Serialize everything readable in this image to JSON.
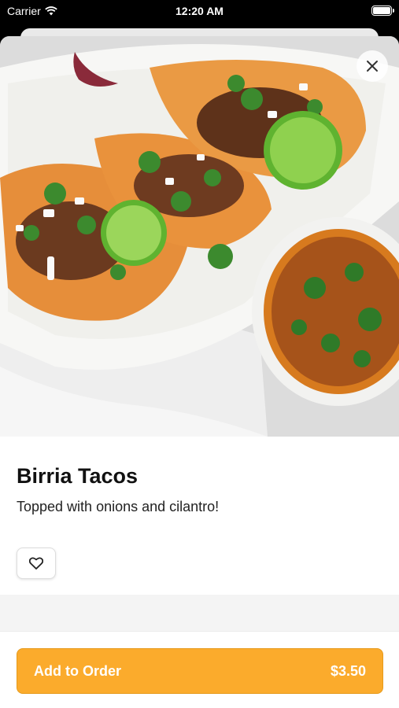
{
  "status_bar": {
    "carrier": "Carrier",
    "time": "12:20 AM"
  },
  "item": {
    "name": "Birria Tacos",
    "description": "Topped with onions and cilantro!",
    "image_icon": "food-photo"
  },
  "actions": {
    "close_icon": "close-icon",
    "favorite_icon": "heart-icon"
  },
  "order": {
    "label": "Add to Order",
    "price": "$3.50"
  },
  "colors": {
    "accent": "#fbab2c",
    "accent_border": "#e69a1b",
    "text_primary": "#111111",
    "sheet_background": "#f4f4f4"
  }
}
